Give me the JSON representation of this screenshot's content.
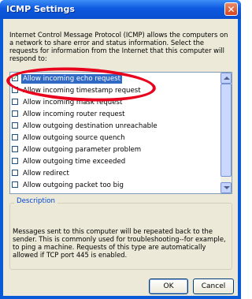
{
  "window": {
    "title": "ICMP Settings",
    "close_glyph": "✕"
  },
  "intro_text": "Internet Control Message Protocol (ICMP) allows the computers on a network to share error and status information. Select the requests for information from the Internet that this computer will respond to:",
  "list": {
    "items": [
      {
        "label": "Allow incoming echo request",
        "checked": true,
        "selected": true
      },
      {
        "label": "Allow incoming timestamp request",
        "checked": false,
        "selected": false
      },
      {
        "label": "Allow incoming mask request",
        "checked": false,
        "selected": false
      },
      {
        "label": "Allow incoming router request",
        "checked": false,
        "selected": false
      },
      {
        "label": "Allow outgoing destination unreachable",
        "checked": false,
        "selected": false
      },
      {
        "label": "Allow outgoing source quench",
        "checked": false,
        "selected": false
      },
      {
        "label": "Allow outgoing parameter problem",
        "checked": false,
        "selected": false
      },
      {
        "label": "Allow outgoing time exceeded",
        "checked": false,
        "selected": false
      },
      {
        "label": "Allow redirect",
        "checked": false,
        "selected": false
      },
      {
        "label": "Allow outgoing packet too big",
        "checked": false,
        "selected": false
      }
    ]
  },
  "description": {
    "title": "Description",
    "text": "Messages sent to this computer will be repeated back to the sender. This is commonly used for troubleshooting--for example, to ping a machine. Requests of this type are automatically allowed if TCP port 445 is enabled."
  },
  "buttons": {
    "ok": "OK",
    "cancel": "Cancel"
  },
  "colors": {
    "highlight": "#e8001c",
    "selection": "#316ac5",
    "title_bar": "#0a5bd8"
  }
}
